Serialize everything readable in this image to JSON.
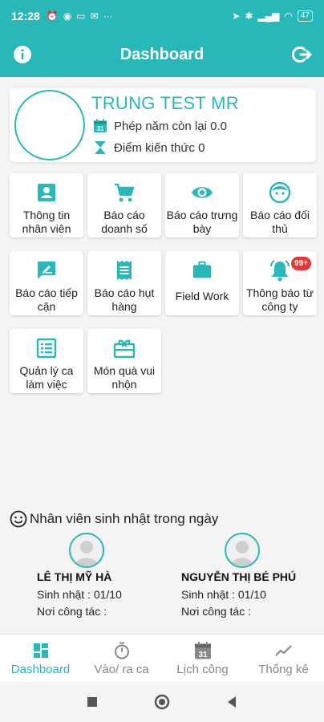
{
  "status_bar": {
    "time": "12:28",
    "battery": "47"
  },
  "app_bar": {
    "title": "Dashboard"
  },
  "profile": {
    "name": "TRUNG TEST MR",
    "leave_text": "Phép năm còn lại 0.0",
    "knowledge_text": "Điểm kiến thức 0",
    "calendar_day": "31"
  },
  "tiles": [
    {
      "label": "Thông tin nhân viên",
      "icon": "person-card-icon"
    },
    {
      "label": "Báo cáo doanh số",
      "icon": "cart-icon"
    },
    {
      "label": "Báo cáo trưng bày",
      "icon": "eye-icon"
    },
    {
      "label": "Báo cáo đối thủ",
      "icon": "face-icon"
    },
    {
      "label": "Báo cáo tiếp cận",
      "icon": "chat-edit-icon"
    },
    {
      "label": "Báo cáo hụt hàng",
      "icon": "receipt-icon"
    },
    {
      "label": "Field Work",
      "icon": "briefcase-icon"
    },
    {
      "label": "Thông báo từ công ty",
      "icon": "bell-icon",
      "badge": "99+"
    },
    {
      "label": "Quản lý ca làm việc",
      "icon": "list-icon"
    },
    {
      "label": "Món quà vui nhộn",
      "icon": "gift-icon"
    }
  ],
  "birthday": {
    "title": "Nhân viên sinh nhật trong ngày",
    "people": [
      {
        "name": "LÊ THỊ MỸ HÀ",
        "birthday": "Sinh nhật : 01/10",
        "workplace": "Nơi công tác :"
      },
      {
        "name": "NGUYỄN THỊ BÉ PHÚ",
        "birthday": "Sinh nhật : 01/10",
        "workplace": "Nơi công tác :"
      }
    ]
  },
  "bottom_nav": [
    {
      "label": "Dashboard",
      "icon": "dashboard-icon",
      "active": true
    },
    {
      "label": "Vào/ ra ca",
      "icon": "stopwatch-icon",
      "active": false
    },
    {
      "label": "Lịch công",
      "icon": "calendar-icon",
      "active": false
    },
    {
      "label": "Thống kê",
      "icon": "trend-icon",
      "active": false
    }
  ],
  "colors": {
    "accent": "#29b8b8",
    "badge": "#e53935"
  }
}
